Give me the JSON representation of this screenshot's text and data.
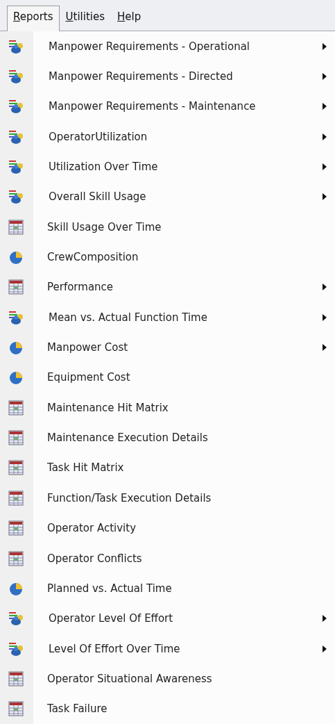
{
  "menu_bar": [
    {
      "label": "Reports",
      "selected": true
    },
    {
      "label": "Utilities",
      "selected": false
    },
    {
      "label": "Help",
      "selected": false
    }
  ],
  "menu_items": [
    {
      "label": "Manpower Requirements - Operational",
      "kind": "people",
      "submenu": true
    },
    {
      "label": "Manpower Requirements - Directed",
      "kind": "people",
      "submenu": true
    },
    {
      "label": "Manpower Requirements - Maintenance",
      "kind": "people",
      "submenu": true
    },
    {
      "label": "OperatorUtilization",
      "kind": "people",
      "submenu": true
    },
    {
      "label": "Utilization Over Time",
      "kind": "people",
      "submenu": true
    },
    {
      "label": "Overall Skill Usage",
      "kind": "people",
      "submenu": true
    },
    {
      "label": "Skill Usage Over Time",
      "kind": "grid",
      "submenu": false
    },
    {
      "label": "CrewComposition",
      "kind": "pie",
      "submenu": false
    },
    {
      "label": "Performance",
      "kind": "grid",
      "submenu": true
    },
    {
      "label": "Mean vs. Actual Function Time",
      "kind": "people",
      "submenu": true
    },
    {
      "label": "Manpower Cost",
      "kind": "pie",
      "submenu": true
    },
    {
      "label": "Equipment Cost",
      "kind": "pie",
      "submenu": false
    },
    {
      "label": "Maintenance Hit Matrix",
      "kind": "grid",
      "submenu": false
    },
    {
      "label": "Maintenance Execution Details",
      "kind": "grid",
      "submenu": false
    },
    {
      "label": "Task Hit Matrix",
      "kind": "grid",
      "submenu": false
    },
    {
      "label": "Function/Task Execution Details",
      "kind": "grid",
      "submenu": false
    },
    {
      "label": "Operator Activity",
      "kind": "grid",
      "submenu": false
    },
    {
      "label": "Operator Conflicts",
      "kind": "grid",
      "submenu": false
    },
    {
      "label": "Planned vs. Actual Time",
      "kind": "pie",
      "submenu": false
    },
    {
      "label": "Operator Level Of Effort",
      "kind": "people",
      "submenu": true
    },
    {
      "label": "Level Of Effort Over Time",
      "kind": "people",
      "submenu": true
    },
    {
      "label": "Operator Situational Awareness",
      "kind": "grid",
      "submenu": false
    },
    {
      "label": "Task Failure",
      "kind": "grid",
      "submenu": false
    }
  ]
}
